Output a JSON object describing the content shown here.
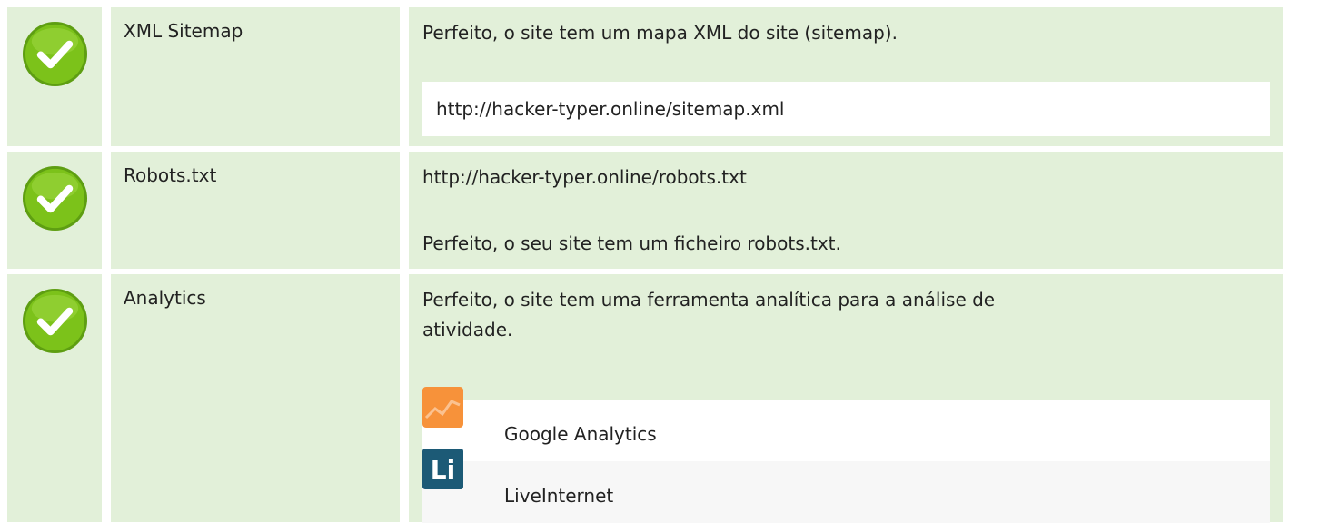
{
  "rows": [
    {
      "name": "XML Sitemap",
      "message": "Perfeito, o site tem um mapa XML do site (sitemap).",
      "url": "http://hacker-typer.online/sitemap.xml",
      "status": "check-icon"
    },
    {
      "name": "Robots.txt",
      "url": "http://hacker-typer.online/robots.txt",
      "message": "Perfeito, o seu site tem um ficheiro robots.txt.",
      "status": "check-icon"
    },
    {
      "name": "Analytics",
      "message_line1": "Perfeito, o site tem uma ferramenta analítica para a análise de",
      "message_line2": "atividade.",
      "status": "check-icon",
      "tools": [
        {
          "name": "Google Analytics",
          "icon": "google-analytics-icon"
        },
        {
          "name": "LiveInternet",
          "icon": "liveinternet-icon",
          "icon_text": "Li"
        }
      ]
    }
  ],
  "colors": {
    "row_bg": "#e2f0d9",
    "check_green": "#7cc21a",
    "analytics_orange": "#f7923a",
    "liveinternet_blue": "#1c5a76"
  }
}
